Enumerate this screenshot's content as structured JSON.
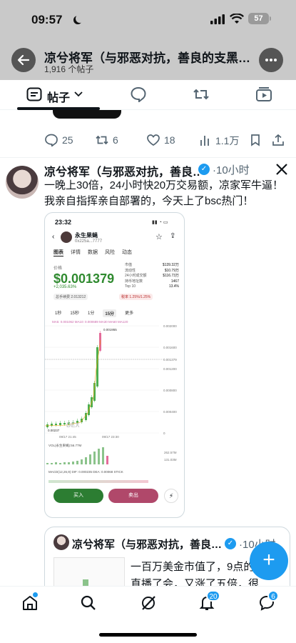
{
  "status": {
    "time": "09:57",
    "battery": "57"
  },
  "header": {
    "title": "凉兮将军（与邪恶对抗，善良的支黑…",
    "subtitle": "1,916 个帖子"
  },
  "tabs": {
    "posts_label": "帖子"
  },
  "prev_post": {
    "replies": "25",
    "reposts": "6",
    "likes": "18",
    "views": "1.1万"
  },
  "post": {
    "name": "凉兮将军（与邪恶对抗，善良…",
    "time": "·10小时",
    "text": "一晚上30倍，24小时快20万交易额，凉家军牛逼！我亲自指挥亲自部署的，今天上了bsc热门！"
  },
  "shot": {
    "time": "23:32",
    "token": "永生果蝇",
    "addr": "0x225a...7777",
    "tabs": [
      "图表",
      "详情",
      "数据",
      "风险",
      "动态"
    ],
    "price_label": "价格",
    "price": "$0.001379",
    "change": "+2,035.63%",
    "stats": [
      [
        "市值",
        "$139.32万"
      ],
      [
        "流动性",
        "$10.79万"
      ],
      [
        "24小时成交额",
        "$116.73万"
      ],
      [
        "持币地址数",
        "1467"
      ],
      [
        "Top 10",
        "13.4%"
      ]
    ],
    "chips": "总手续费 2.013212",
    "tax": "税率 1.25%/1.25%",
    "intervals": [
      "1秒",
      "15秒",
      "1分",
      "15分",
      "更多"
    ],
    "ma": "MA5: 0.001062  MA10: 0.000689  MA30  MA60  MA120",
    "y_labels": [
      "0.002000",
      "0.001600",
      "0.001379",
      "0.001200",
      "0.000800",
      "0.000400",
      "0"
    ],
    "high_label": "0.001955",
    "low_label": "0.00237",
    "x_labels": [
      "09/17 21:45",
      "09/17 23:30"
    ],
    "vol_label": "VOL(永生果蝇):56.77M",
    "vol_ticks": [
      "262.57M",
      "131.03M"
    ],
    "macd_label": "MACD(12,26,9) DIF: 0.000235  DEA: 0.00068  STICK",
    "buy": "买入",
    "sell": "卖出",
    "watermark": "DEX"
  },
  "post2": {
    "name": "凉兮将军（与邪恶对抗，善良…",
    "time": "·10小时",
    "text_lines": [
      "一百万美金市值了，9点的",
      "直播了会，又涨了五倍，很"
    ]
  },
  "nav": {
    "notif_badge": "20",
    "msg_badge": "6"
  }
}
